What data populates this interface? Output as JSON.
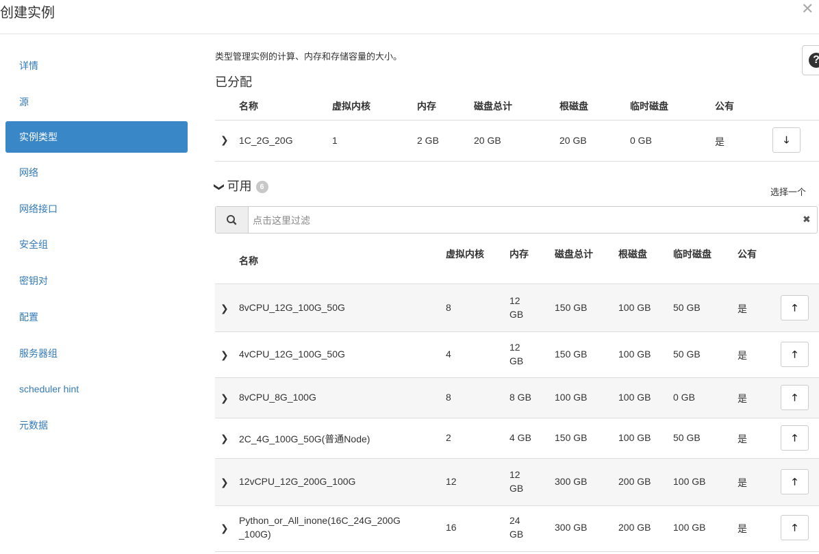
{
  "modal": {
    "title": "创建实例",
    "close_icon": "close-icon"
  },
  "nav": {
    "items": [
      "详情",
      "源",
      "实例类型",
      "网络",
      "网络接口",
      "安全组",
      "密钥对",
      "配置",
      "服务器组",
      "scheduler hint",
      "元数据"
    ],
    "active": "实例类型"
  },
  "main": {
    "description": "类型管理实例的计算、内存和存储容量的大小。",
    "allocated_title": "已分配",
    "available_title": "可用",
    "available_count": "6",
    "select_one": "选择一个",
    "columns": [
      "名称",
      "虚拟内核",
      "内存",
      "磁盘总计",
      "根磁盘",
      "临时磁盘",
      "公有"
    ],
    "filter_placeholder": "点击这里过滤"
  },
  "allocated_rows": [
    {
      "name": "1C_2G_20G",
      "vcpus": "1",
      "ram": "2 GB",
      "total_disk": "20 GB",
      "root_disk": "20 GB",
      "ephemeral": "0 GB",
      "public": "是"
    }
  ],
  "available_rows": [
    {
      "name": "8vCPU_12G_100G_50G",
      "name2": "",
      "vcpus": "8",
      "ram": "12",
      "ram2": "GB",
      "total_disk": "150 GB",
      "root_disk": "100 GB",
      "ephemeral": "50 GB",
      "public": "是"
    },
    {
      "name": "4vCPU_12G_100G_50G",
      "name2": "",
      "vcpus": "4",
      "ram": "12",
      "ram2": "GB",
      "total_disk": "150 GB",
      "root_disk": "100 GB",
      "ephemeral": "50 GB",
      "public": "是"
    },
    {
      "name": "8vCPU_8G_100G",
      "name2": "",
      "vcpus": "8",
      "ram": "8 GB",
      "ram2": "",
      "total_disk": "100 GB",
      "root_disk": "100 GB",
      "ephemeral": "0 GB",
      "public": "是"
    },
    {
      "name": "2C_4G_100G_50G(普通Node)",
      "name2": "",
      "vcpus": "2",
      "ram": "4 GB",
      "ram2": "",
      "total_disk": "150 GB",
      "root_disk": "100 GB",
      "ephemeral": "50 GB",
      "public": "是"
    },
    {
      "name": "12vCPU_12G_200G_100G",
      "name2": "",
      "vcpus": "12",
      "ram": "12",
      "ram2": "GB",
      "total_disk": "300 GB",
      "root_disk": "200 GB",
      "ephemeral": "100 GB",
      "public": "是"
    },
    {
      "name": "Python_or_All_inone(16C_24G_200G",
      "name2": "_100G)",
      "vcpus": "16",
      "ram": "24",
      "ram2": "GB",
      "total_disk": "300 GB",
      "root_disk": "200 GB",
      "ephemeral": "100 GB",
      "public": "是"
    }
  ],
  "colors": {
    "accent": "#3a87c8",
    "link": "#337ab7",
    "badge": "#c8c8c8"
  }
}
